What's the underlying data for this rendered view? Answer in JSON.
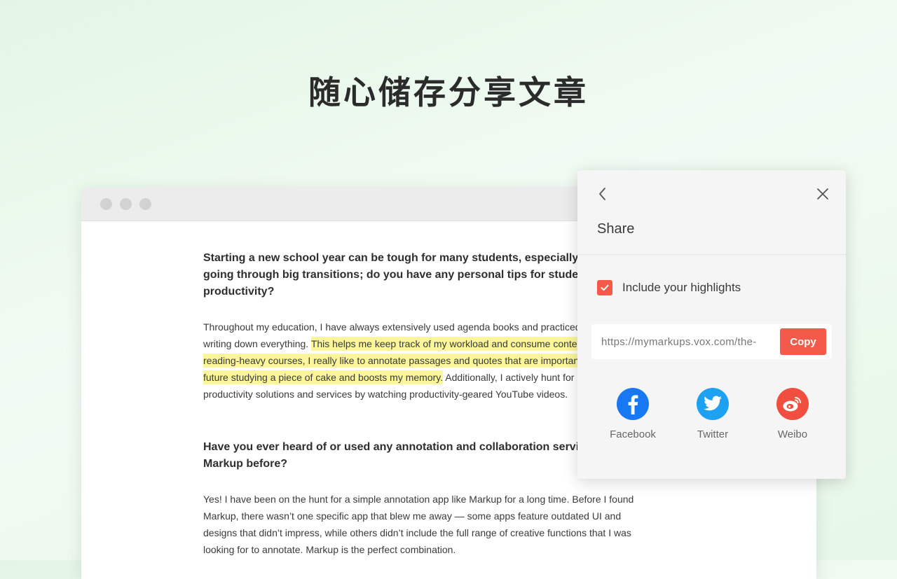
{
  "hero": {
    "title": "随心储存分享文章"
  },
  "article": {
    "q1": "Starting a new school year can be tough for many students, especially those going through big transitions; do you have any personal tips for student productivity?",
    "p1_before": "Throughout my education, I have always extensively used agenda books and practiced the habit of writing down everything. ",
    "p1_highlight": "This helps me keep track of my workload and consume content easily. In reading-heavy courses, I really like to annotate passages and quotes that are important; this makes future studying a piece of cake and boosts my memory.",
    "p1_after": " Additionally, I actively hunt for new productivity solutions and services by watching productivity-geared YouTube videos.",
    "q2": "Have you ever heard of or used any annotation and collaboration services like Markup before?",
    "p2": "Yes! I have been on the hunt for a simple annotation app like Markup for a long time. Before I found Markup, there wasn’t one specific app that blew me away — some apps feature outdated UI and designs that didn’t impress, while others didn’t include the full range of creative functions that I was looking for to annotate. Markup is the perfect combination."
  },
  "share": {
    "title": "Share",
    "include_label": "Include your highlights",
    "include_checked": true,
    "link_url": "https://mymarkups.vox.com/the-",
    "copy_label": "Copy",
    "accent_color": "#f45a4a",
    "socials": [
      {
        "name": "Facebook",
        "icon": "facebook-icon",
        "color": "#1877f2"
      },
      {
        "name": "Twitter",
        "icon": "twitter-icon",
        "color": "#1da1f2"
      },
      {
        "name": "Weibo",
        "icon": "weibo-icon",
        "color": "#f04e3e"
      }
    ]
  }
}
